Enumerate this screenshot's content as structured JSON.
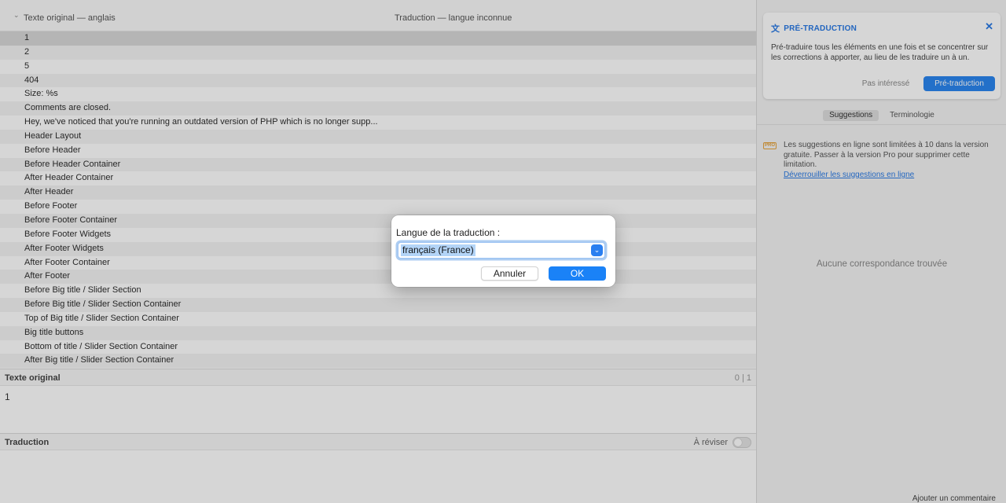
{
  "list_header": {
    "source_column": "Texte original — anglais",
    "target_column": "Traduction — langue inconnue"
  },
  "strings": [
    "1",
    "2",
    "5",
    "404",
    "Size: %s",
    "Comments are closed.",
    "Hey, we've noticed that you're running an outdated version of PHP which is no longer supp...",
    "Header Layout",
    "Before Header",
    "Before Header Container",
    "After Header Container",
    "After Header",
    "Before Footer",
    "Before Footer Container",
    "Before Footer Widgets",
    "After Footer Widgets",
    "After Footer Container",
    "After Footer",
    "Before Big title / Slider Section",
    "Before Big title / Slider Section Container",
    "Top of Big title / Slider Section Container",
    "Big title buttons",
    "Bottom of title / Slider Section Container",
    "After Big title / Slider Section Container"
  ],
  "source_editor": {
    "label": "Texte original",
    "counter": "0 | 1",
    "text": "1"
  },
  "translation_editor": {
    "label": "Traduction",
    "review_label": "À réviser"
  },
  "pretranslation": {
    "title": "PRÉ-TRADUCTION",
    "body": "Pré-traduire tous les éléments en une fois et se concentrer sur les corrections à apporter, au lieu de les traduire un à un.",
    "dismiss_label": "Pas intéressé",
    "action_label": "Pré-traduction"
  },
  "side_tabs": {
    "suggestions": "Suggestions",
    "terminology": "Terminologie"
  },
  "notice": {
    "badge": "PRO",
    "text": "Les suggestions en ligne sont limitées à 10 dans la version gratuite. Passer à la version Pro pour supprimer cette limitation.",
    "link": "Déverrouiller les suggestions en ligne"
  },
  "no_match": "Aucune correspondance trouvée",
  "add_comment": "Ajouter un commentaire",
  "dialog": {
    "label": "Langue de la traduction :",
    "selected_language": "français (France)",
    "cancel_label": "Annuler",
    "ok_label": "OK"
  },
  "colors": {
    "accent": "#1a82f7",
    "link": "#2a7ae4",
    "pro_badge": "#e5a23a"
  }
}
